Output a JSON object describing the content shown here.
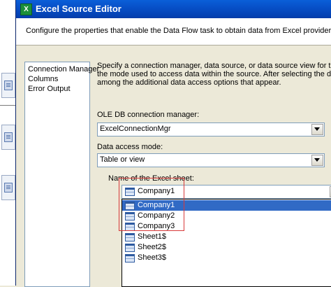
{
  "window": {
    "title": "Excel Source Editor",
    "description": "Configure the properties that enable the Data Flow task to obtain data from Excel provider."
  },
  "nav": {
    "items": [
      "Connection Manager",
      "Columns",
      "Error Output"
    ]
  },
  "main": {
    "info_lines": [
      "Specify a connection manager, data source, or data source view for the Excel source",
      "the mode used to access data within the source. After selecting the data access mode",
      "among the additional data access options that appear."
    ],
    "connection_label": "OLE DB connection manager:",
    "connection_value": "ExcelConnectionMgr",
    "access_mode_label": "Data access mode:",
    "access_mode_value": "Table or view",
    "sheet_label": "Name of the Excel sheet:",
    "sheet_value": "Company1",
    "sheet_options": [
      "Company1",
      "Company2",
      "Company3",
      "Sheet1$",
      "Sheet2$",
      "Sheet3$"
    ],
    "selected_index": 0
  },
  "colors": {
    "title_bar": "#0a5fd8",
    "selection": "#316ac5",
    "annotation_box": "#d83a3a"
  }
}
